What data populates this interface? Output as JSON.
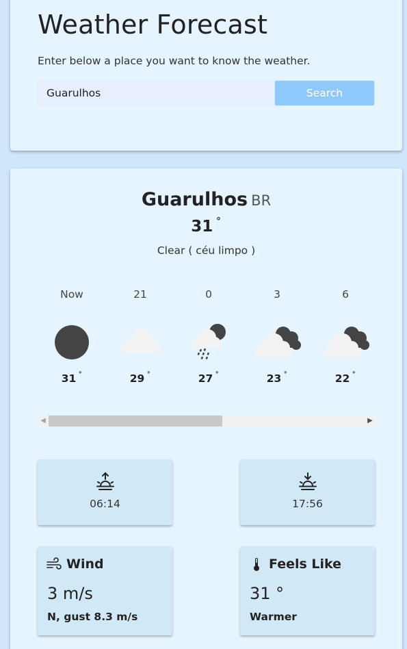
{
  "header": {
    "title": "Weather Forecast",
    "subtitle": "Enter below a place you want to know the weather.",
    "search_value": "Guarulhos",
    "search_button": "Search"
  },
  "current": {
    "city": "Guarulhos",
    "country": "BR",
    "temp": "31",
    "degree_symbol": "˚",
    "description": "Clear ( céu limpo )"
  },
  "hourly": [
    {
      "label": "Now",
      "icon": "clear-night-icon",
      "temp": "31"
    },
    {
      "label": "21",
      "icon": "cloud-icon",
      "temp": "29"
    },
    {
      "label": "0",
      "icon": "rain-night-icon",
      "temp": "27"
    },
    {
      "label": "3",
      "icon": "cloudy-night-icon",
      "temp": "23"
    },
    {
      "label": "6",
      "icon": "cloudy-night-icon",
      "temp": "22"
    }
  ],
  "sun": {
    "sunrise": "06:14",
    "sunset": "17:56"
  },
  "wind": {
    "title": "Wind",
    "value": "3 m/s",
    "detail": "N, gust 8.3 m/s"
  },
  "feels_like": {
    "title": "Feels Like",
    "value": "31 °",
    "detail": "Warmer"
  },
  "colors": {
    "page_bg": "#cfe6fb",
    "card_bg": "#e5f4fe",
    "tile_bg": "#d1e9f7",
    "button_bg": "#8fc9fb",
    "icon_dark": "#444444",
    "cloud": "#f2f2f2"
  }
}
